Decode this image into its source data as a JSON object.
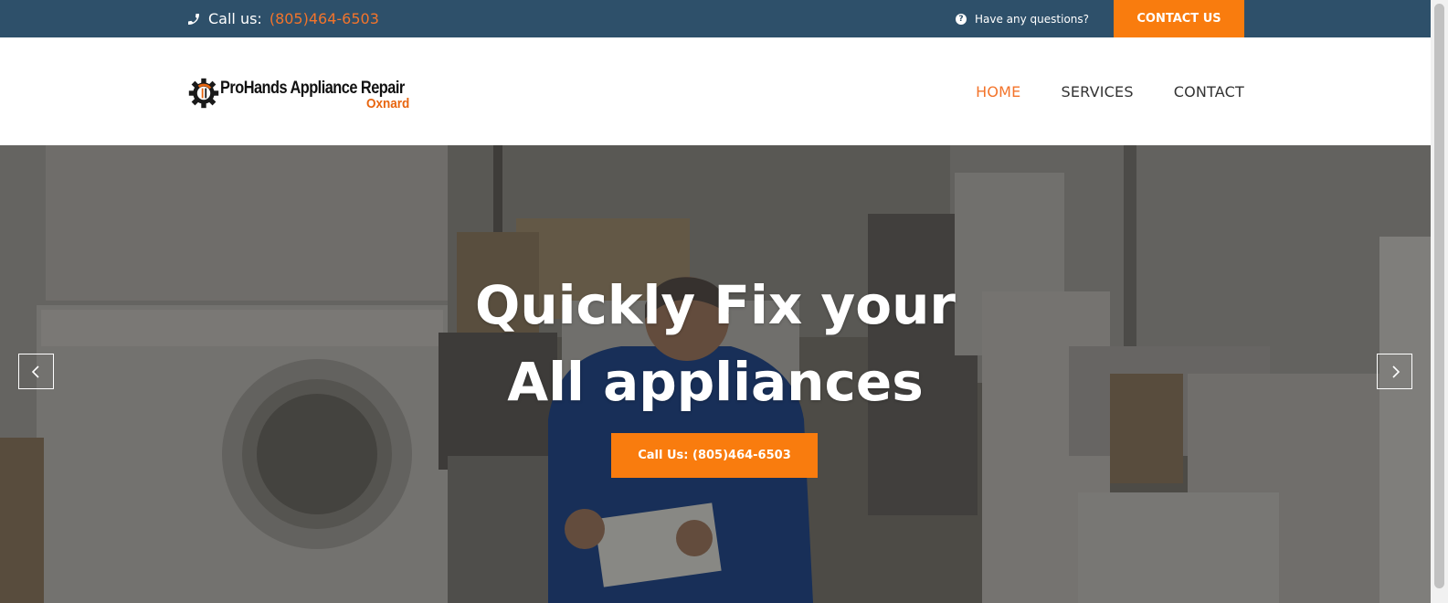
{
  "topbar": {
    "call_label": "Call us:",
    "phone": "(805)464-6503",
    "questions": "Have any questions?",
    "contact_button": "CONTACT US",
    "bg_color": "#2e506a",
    "accent_color": "#f97c0e"
  },
  "logo": {
    "brand": "ProHands Appliance Repair",
    "city": "Oxnard"
  },
  "nav": {
    "items": [
      {
        "label": "HOME",
        "active": true
      },
      {
        "label": "SERVICES",
        "active": false
      },
      {
        "label": "CONTACT",
        "active": false
      }
    ]
  },
  "hero": {
    "title_line1": "Quickly Fix your",
    "title_line2": "All appliances",
    "button": "Call Us: (805)464-6503",
    "prev_icon": "chevron-left-icon",
    "next_icon": "chevron-right-icon"
  }
}
